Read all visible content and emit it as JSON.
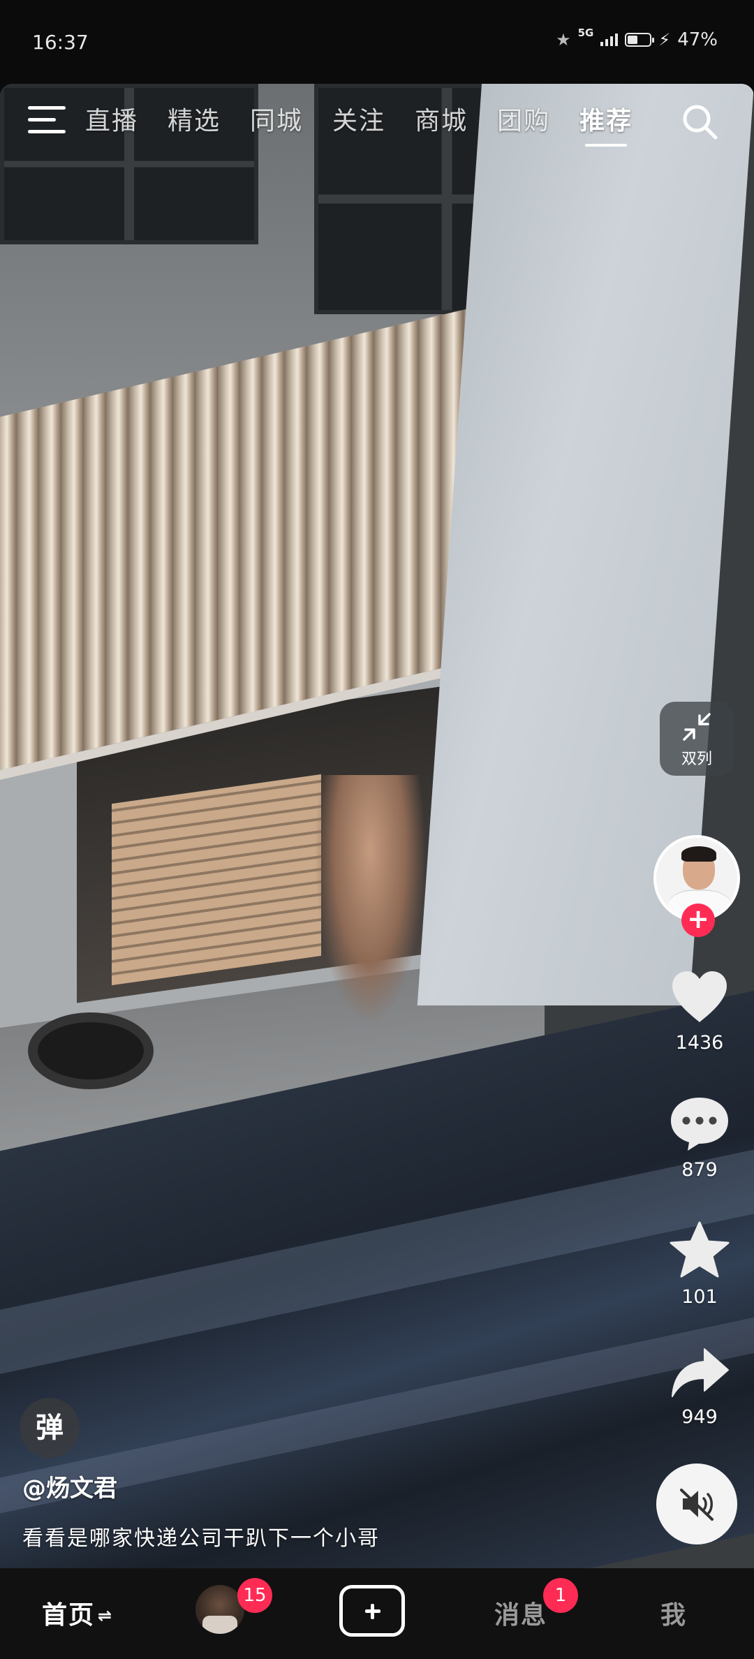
{
  "status_bar": {
    "time": "16:37",
    "network": "5G",
    "battery_percent": "47%",
    "battery_level": 0.47
  },
  "top_nav": {
    "tabs": [
      {
        "label": "直播",
        "active": false
      },
      {
        "label": "精选",
        "active": false
      },
      {
        "label": "同城",
        "active": false
      },
      {
        "label": "关注",
        "active": false
      },
      {
        "label": "商城",
        "active": false
      },
      {
        "label": "团购",
        "active": false
      },
      {
        "label": "推荐",
        "active": true
      }
    ],
    "menu_icon": "menu-icon",
    "search_icon": "search-icon"
  },
  "side_actions": {
    "dual_column_label": "双列",
    "likes": "1436",
    "comments": "879",
    "favorites": "101",
    "shares": "949"
  },
  "video_info": {
    "danmu_label": "弹",
    "author": "@炀文君",
    "caption": "看看是哪家快递公司干趴下一个小哥"
  },
  "bottom_nav": {
    "home_label": "首页",
    "home_swap_icon": "⇌",
    "friends_badge": "15",
    "messages_label": "消息",
    "messages_badge": "1",
    "me_label": "我"
  },
  "colors": {
    "accent": "#fe2c55",
    "nav_bg": "#111111"
  }
}
